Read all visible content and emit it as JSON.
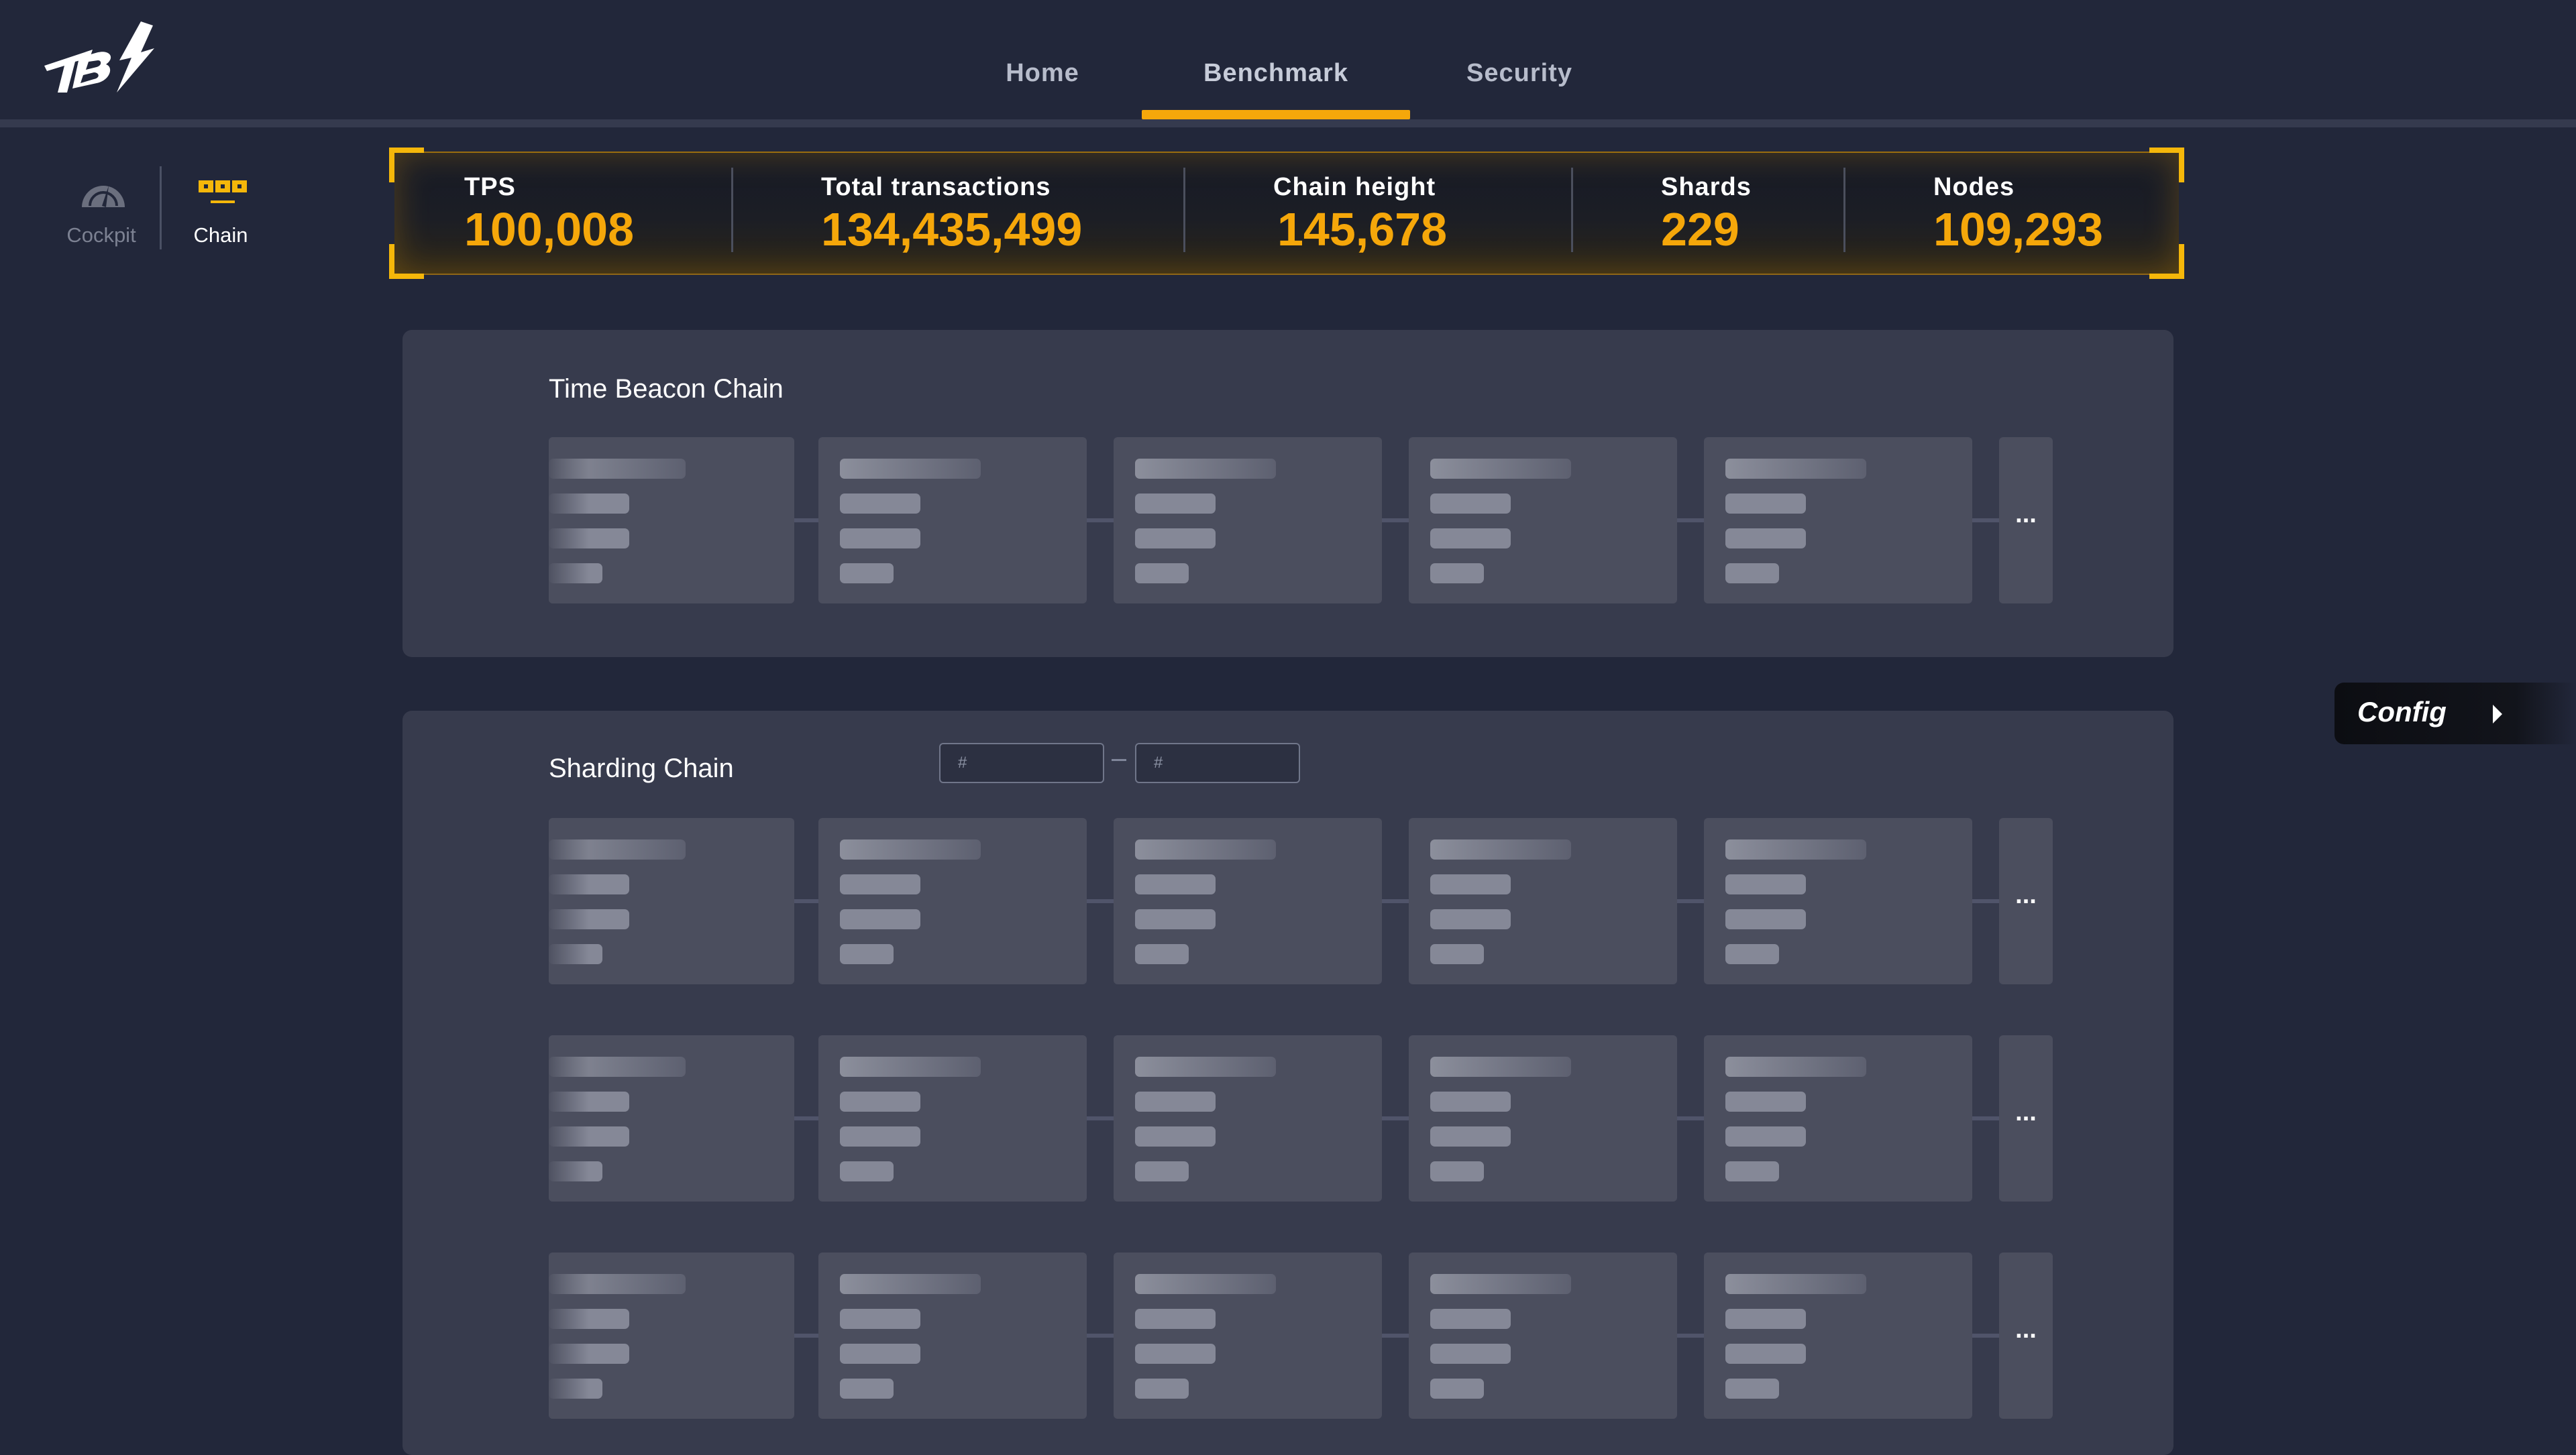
{
  "nav": {
    "tabs": [
      "Home",
      "Benchmark",
      "Security"
    ],
    "active": "Benchmark"
  },
  "sidebar": {
    "items": [
      {
        "label": "Cockpit",
        "icon": "speedometer-icon"
      },
      {
        "label": "Chain",
        "icon": "chain-icon",
        "active": true
      }
    ]
  },
  "stats": {
    "tps_label": "TPS",
    "tps_value": "100,008",
    "tx_label": "Total  transactions",
    "tx_value": "134,435,499",
    "height_label": "Chain  height",
    "height_value": "145,678",
    "shards_label": "Shards",
    "shards_value": "229",
    "nodes_label": "Nodes",
    "nodes_value": "109,293"
  },
  "beacon": {
    "title": "Time Beacon Chain",
    "more": "..."
  },
  "sharding": {
    "title": "Sharding Chain",
    "from_placeholder": "#",
    "to_placeholder": "#",
    "more": "..."
  },
  "config": {
    "label": "Config"
  },
  "colors": {
    "accent": "#f5a70a",
    "background": "#22273a",
    "panel": "#373b4d",
    "block": "#4b4e5e"
  }
}
